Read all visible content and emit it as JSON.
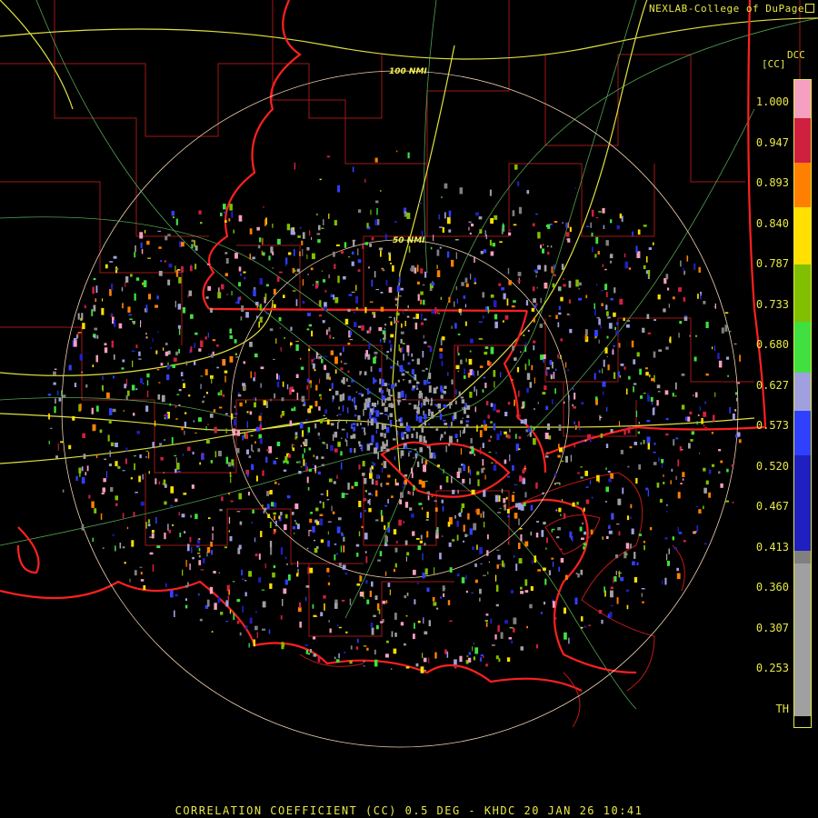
{
  "credit": "NEXLAB-College of DuPage",
  "credit_icon": "external-box-icon",
  "legend": {
    "product": "DCC",
    "unit": "[CC]",
    "labels": [
      "1.000",
      "0.947",
      "0.893",
      "0.840",
      "0.787",
      "0.733",
      "0.680",
      "0.627",
      "0.573",
      "0.520",
      "0.467",
      "0.413",
      "0.360",
      "0.307",
      "0.253",
      "TH"
    ],
    "colors": [
      "#f5a0c0",
      "#d02040",
      "#ff8000",
      "#ffe000",
      "#80c000",
      "#40e040",
      "#a0a0e0",
      "#3040ff",
      "#2020c0",
      "#808080",
      "#a0a0a0"
    ]
  },
  "range_rings": {
    "inner": "50 NMI",
    "outer": "100 NMI"
  },
  "caption": "CORRELATION COEFFICIENT (CC) 0.5 DEG - KHDC 20 JAN 26 10:41",
  "colors": {
    "text": "#e8e84a",
    "state_border": "#ff2020",
    "county_border": "#a01818",
    "highway": "#e0e040",
    "road": "#60c060",
    "ring": "#f0d0b0"
  }
}
